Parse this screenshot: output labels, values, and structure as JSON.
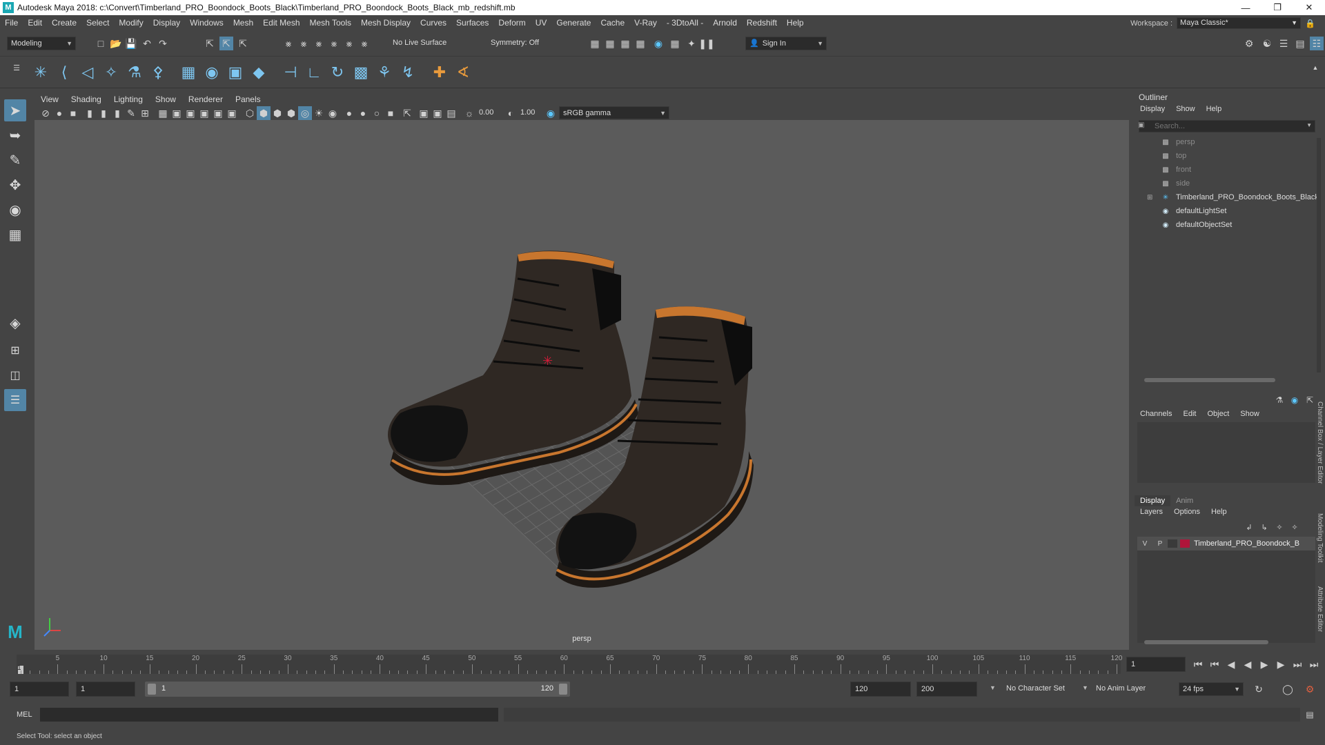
{
  "window": {
    "title": "Autodesk Maya 2018: c:\\Convert\\Timberland_PRO_Boondock_Boots_Black\\Timberland_PRO_Boondock_Boots_Black_mb_redshift.mb",
    "logo_letter": "M"
  },
  "menubar": {
    "items": [
      "File",
      "Edit",
      "Create",
      "Select",
      "Modify",
      "Display",
      "Windows",
      "Mesh",
      "Edit Mesh",
      "Mesh Tools",
      "Mesh Display",
      "Curves",
      "Surfaces",
      "Deform",
      "UV",
      "Generate",
      "Cache",
      "V-Ray",
      "- 3DtoAll -",
      "Arnold",
      "Redshift",
      "Help"
    ]
  },
  "workspace": {
    "label": "Workspace :",
    "value": "Maya Classic*"
  },
  "statusline": {
    "mode": "Modeling",
    "live_surface": "No Live Surface",
    "symmetry": "Symmetry: Off",
    "sign_in": "Sign In"
  },
  "viewport": {
    "menu": [
      "View",
      "Shading",
      "Lighting",
      "Show",
      "Renderer",
      "Panels"
    ],
    "exposure": "0.00",
    "gamma": "1.00",
    "color_space": "sRGB gamma",
    "camera_label": "persp"
  },
  "outliner": {
    "title": "Outliner",
    "menu": [
      "Display",
      "Show",
      "Help"
    ],
    "search_placeholder": "Search...",
    "items": [
      {
        "label": "persp",
        "icon": "camera-icon",
        "dim": true
      },
      {
        "label": "top",
        "icon": "camera-icon",
        "dim": true
      },
      {
        "label": "front",
        "icon": "camera-icon",
        "dim": true
      },
      {
        "label": "side",
        "icon": "camera-icon",
        "dim": true
      },
      {
        "label": "Timberland_PRO_Boondock_Boots_Black",
        "icon": "group-icon",
        "dim": false
      },
      {
        "label": "defaultLightSet",
        "icon": "set-icon",
        "dim": false
      },
      {
        "label": "defaultObjectSet",
        "icon": "set-icon",
        "dim": false
      }
    ]
  },
  "channelbox": {
    "menu": [
      "Channels",
      "Edit",
      "Object",
      "Show"
    ],
    "side_tabs": [
      "Channel Box / Layer Editor",
      "Modeling Toolkit",
      "Attribute Editor"
    ]
  },
  "layer_editor": {
    "tabs": [
      "Display",
      "Anim"
    ],
    "menu": [
      "Layers",
      "Options",
      "Help"
    ],
    "layer": {
      "v": "V",
      "p": "P",
      "name": "Timberland_PRO_Boondock_B",
      "color": "#b0153a"
    }
  },
  "timeline": {
    "ticks": [
      "5",
      "10",
      "15",
      "20",
      "25",
      "30",
      "35",
      "40",
      "45",
      "50",
      "55",
      "60",
      "65",
      "70",
      "75",
      "80",
      "85",
      "90",
      "95",
      "100",
      "105",
      "110",
      "115",
      "120"
    ],
    "start_marker": "1",
    "current_frame": "1"
  },
  "range": {
    "start": "1",
    "playback_start": "1",
    "slider_start": "1",
    "slider_end": "120",
    "playback_end": "120",
    "end": "200",
    "character_set": "No Character Set",
    "anim_layer": "No Anim Layer",
    "fps": "24 fps"
  },
  "command": {
    "label": "MEL"
  },
  "helpline": {
    "text": "Select Tool: select an object"
  },
  "colors": {
    "accent": "#5285a6",
    "panel": "#444444",
    "viewport": "#5b5b5b",
    "field": "#2b2b2b"
  }
}
